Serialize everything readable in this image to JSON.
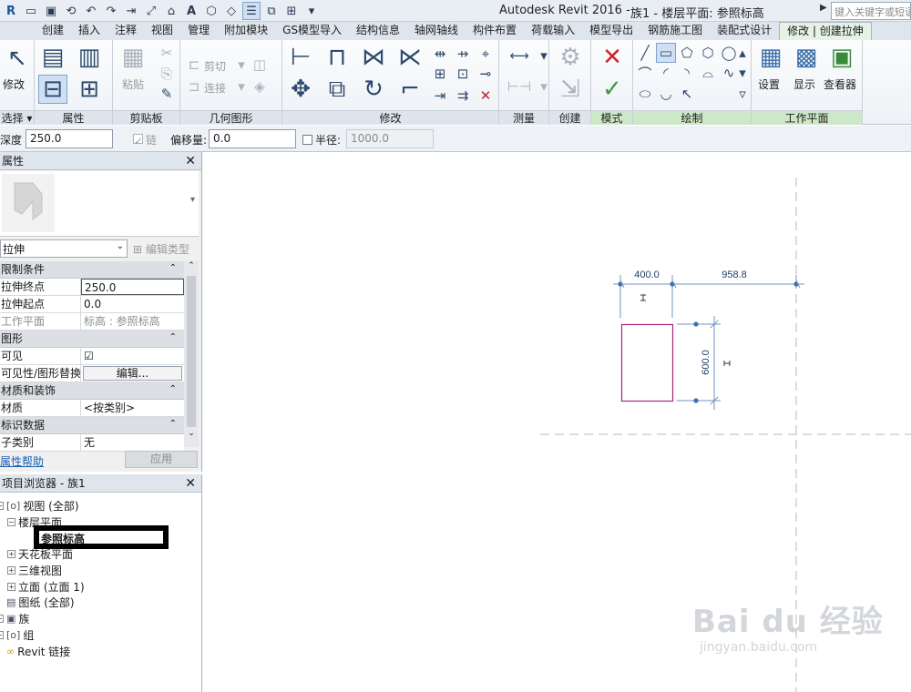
{
  "app": {
    "title": "Autodesk Revit 2016 -",
    "document": "族1 - 楼层平面: 参照标高",
    "search_placeholder": "键入关键字或短语"
  },
  "tabs": [
    {
      "label": "创建"
    },
    {
      "label": "插入"
    },
    {
      "label": "注释"
    },
    {
      "label": "视图"
    },
    {
      "label": "管理"
    },
    {
      "label": "附加模块"
    },
    {
      "label": "GS模型导入"
    },
    {
      "label": "结构信息"
    },
    {
      "label": "轴网轴线"
    },
    {
      "label": "构件布置"
    },
    {
      "label": "荷载输入"
    },
    {
      "label": "模型导出"
    },
    {
      "label": "钢筋施工图"
    },
    {
      "label": "装配式设计"
    },
    {
      "label": "修改 | 创建拉伸"
    }
  ],
  "ribbon": {
    "modify_label": "修改",
    "select_label": "选择",
    "panels": {
      "properties": "属性",
      "clipboard": "剪贴板",
      "geometry": "几何图形",
      "modify": "修改",
      "measure": "测量",
      "create": "创建",
      "mode": "模式",
      "draw": "绘制",
      "workplane": "工作平面"
    },
    "paste_label": "粘贴",
    "cut_label": "剪切",
    "join_label": "连接",
    "wp_buttons": {
      "set": "设置",
      "show": "显示",
      "viewer": "查看器"
    }
  },
  "options": {
    "depth_label": "深度",
    "depth_value": "250.0",
    "chain_label": "链",
    "offset_label": "偏移量:",
    "offset_value": "0.0",
    "radius_label": "半径:",
    "radius_value": "1000.0"
  },
  "properties": {
    "title": "属性",
    "type_name": "拉伸",
    "edit_type": "编辑类型",
    "groups": [
      {
        "name": "限制条件",
        "rows": [
          {
            "key": "拉伸终点",
            "value": "250.0"
          },
          {
            "key": "拉伸起点",
            "value": "0.0"
          },
          {
            "key": "工作平面",
            "value": "标高 : 参照标高"
          }
        ]
      },
      {
        "name": "图形",
        "rows": [
          {
            "key": "可见",
            "value": "☑"
          },
          {
            "key": "可见性/图形替换",
            "value": "编辑..."
          }
        ]
      },
      {
        "name": "材质和装饰",
        "rows": [
          {
            "key": "材质",
            "value": "<按类别>"
          }
        ]
      },
      {
        "name": "标识数据",
        "rows": [
          {
            "key": "子类别",
            "value": "无"
          }
        ]
      }
    ],
    "help": "属性帮助",
    "apply": "应用"
  },
  "browser": {
    "title": "项目浏览器 - 族1",
    "nodes": {
      "views": "视图 (全部)",
      "floor_plans": "楼层平面",
      "ref_level": "参照标高",
      "ceiling": "天花板平面",
      "threed": "三维视图",
      "elevation": "立面 (立面 1)",
      "sheets": "图纸 (全部)",
      "families": "族",
      "groups": "组",
      "links": "Revit 链接"
    }
  },
  "canvas": {
    "dim_width": "400.0",
    "dim_offset": "958.8",
    "dim_height": "600.0"
  },
  "watermark": {
    "brand": "Bai du 经验",
    "url": "jingyan.baidu.com"
  }
}
